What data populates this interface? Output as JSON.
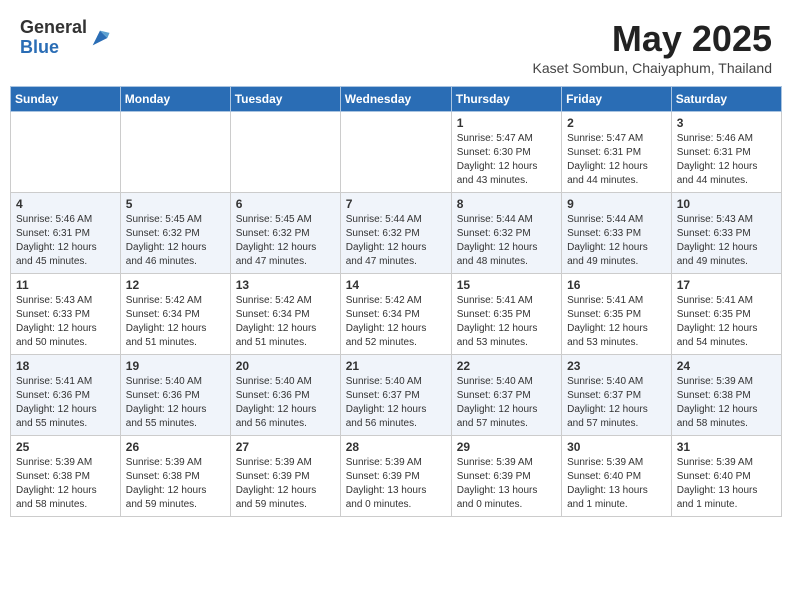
{
  "header": {
    "logo_line1": "General",
    "logo_line2": "Blue",
    "month": "May 2025",
    "location": "Kaset Sombun, Chaiyaphum, Thailand"
  },
  "weekdays": [
    "Sunday",
    "Monday",
    "Tuesday",
    "Wednesday",
    "Thursday",
    "Friday",
    "Saturday"
  ],
  "weeks": [
    [
      {
        "day": "",
        "content": ""
      },
      {
        "day": "",
        "content": ""
      },
      {
        "day": "",
        "content": ""
      },
      {
        "day": "",
        "content": ""
      },
      {
        "day": "1",
        "content": "Sunrise: 5:47 AM\nSunset: 6:30 PM\nDaylight: 12 hours\nand 43 minutes."
      },
      {
        "day": "2",
        "content": "Sunrise: 5:47 AM\nSunset: 6:31 PM\nDaylight: 12 hours\nand 44 minutes."
      },
      {
        "day": "3",
        "content": "Sunrise: 5:46 AM\nSunset: 6:31 PM\nDaylight: 12 hours\nand 44 minutes."
      }
    ],
    [
      {
        "day": "4",
        "content": "Sunrise: 5:46 AM\nSunset: 6:31 PM\nDaylight: 12 hours\nand 45 minutes."
      },
      {
        "day": "5",
        "content": "Sunrise: 5:45 AM\nSunset: 6:32 PM\nDaylight: 12 hours\nand 46 minutes."
      },
      {
        "day": "6",
        "content": "Sunrise: 5:45 AM\nSunset: 6:32 PM\nDaylight: 12 hours\nand 47 minutes."
      },
      {
        "day": "7",
        "content": "Sunrise: 5:44 AM\nSunset: 6:32 PM\nDaylight: 12 hours\nand 47 minutes."
      },
      {
        "day": "8",
        "content": "Sunrise: 5:44 AM\nSunset: 6:32 PM\nDaylight: 12 hours\nand 48 minutes."
      },
      {
        "day": "9",
        "content": "Sunrise: 5:44 AM\nSunset: 6:33 PM\nDaylight: 12 hours\nand 49 minutes."
      },
      {
        "day": "10",
        "content": "Sunrise: 5:43 AM\nSunset: 6:33 PM\nDaylight: 12 hours\nand 49 minutes."
      }
    ],
    [
      {
        "day": "11",
        "content": "Sunrise: 5:43 AM\nSunset: 6:33 PM\nDaylight: 12 hours\nand 50 minutes."
      },
      {
        "day": "12",
        "content": "Sunrise: 5:42 AM\nSunset: 6:34 PM\nDaylight: 12 hours\nand 51 minutes."
      },
      {
        "day": "13",
        "content": "Sunrise: 5:42 AM\nSunset: 6:34 PM\nDaylight: 12 hours\nand 51 minutes."
      },
      {
        "day": "14",
        "content": "Sunrise: 5:42 AM\nSunset: 6:34 PM\nDaylight: 12 hours\nand 52 minutes."
      },
      {
        "day": "15",
        "content": "Sunrise: 5:41 AM\nSunset: 6:35 PM\nDaylight: 12 hours\nand 53 minutes."
      },
      {
        "day": "16",
        "content": "Sunrise: 5:41 AM\nSunset: 6:35 PM\nDaylight: 12 hours\nand 53 minutes."
      },
      {
        "day": "17",
        "content": "Sunrise: 5:41 AM\nSunset: 6:35 PM\nDaylight: 12 hours\nand 54 minutes."
      }
    ],
    [
      {
        "day": "18",
        "content": "Sunrise: 5:41 AM\nSunset: 6:36 PM\nDaylight: 12 hours\nand 55 minutes."
      },
      {
        "day": "19",
        "content": "Sunrise: 5:40 AM\nSunset: 6:36 PM\nDaylight: 12 hours\nand 55 minutes."
      },
      {
        "day": "20",
        "content": "Sunrise: 5:40 AM\nSunset: 6:36 PM\nDaylight: 12 hours\nand 56 minutes."
      },
      {
        "day": "21",
        "content": "Sunrise: 5:40 AM\nSunset: 6:37 PM\nDaylight: 12 hours\nand 56 minutes."
      },
      {
        "day": "22",
        "content": "Sunrise: 5:40 AM\nSunset: 6:37 PM\nDaylight: 12 hours\nand 57 minutes."
      },
      {
        "day": "23",
        "content": "Sunrise: 5:40 AM\nSunset: 6:37 PM\nDaylight: 12 hours\nand 57 minutes."
      },
      {
        "day": "24",
        "content": "Sunrise: 5:39 AM\nSunset: 6:38 PM\nDaylight: 12 hours\nand 58 minutes."
      }
    ],
    [
      {
        "day": "25",
        "content": "Sunrise: 5:39 AM\nSunset: 6:38 PM\nDaylight: 12 hours\nand 58 minutes."
      },
      {
        "day": "26",
        "content": "Sunrise: 5:39 AM\nSunset: 6:38 PM\nDaylight: 12 hours\nand 59 minutes."
      },
      {
        "day": "27",
        "content": "Sunrise: 5:39 AM\nSunset: 6:39 PM\nDaylight: 12 hours\nand 59 minutes."
      },
      {
        "day": "28",
        "content": "Sunrise: 5:39 AM\nSunset: 6:39 PM\nDaylight: 13 hours\nand 0 minutes."
      },
      {
        "day": "29",
        "content": "Sunrise: 5:39 AM\nSunset: 6:39 PM\nDaylight: 13 hours\nand 0 minutes."
      },
      {
        "day": "30",
        "content": "Sunrise: 5:39 AM\nSunset: 6:40 PM\nDaylight: 13 hours\nand 1 minute."
      },
      {
        "day": "31",
        "content": "Sunrise: 5:39 AM\nSunset: 6:40 PM\nDaylight: 13 hours\nand 1 minute."
      }
    ]
  ]
}
